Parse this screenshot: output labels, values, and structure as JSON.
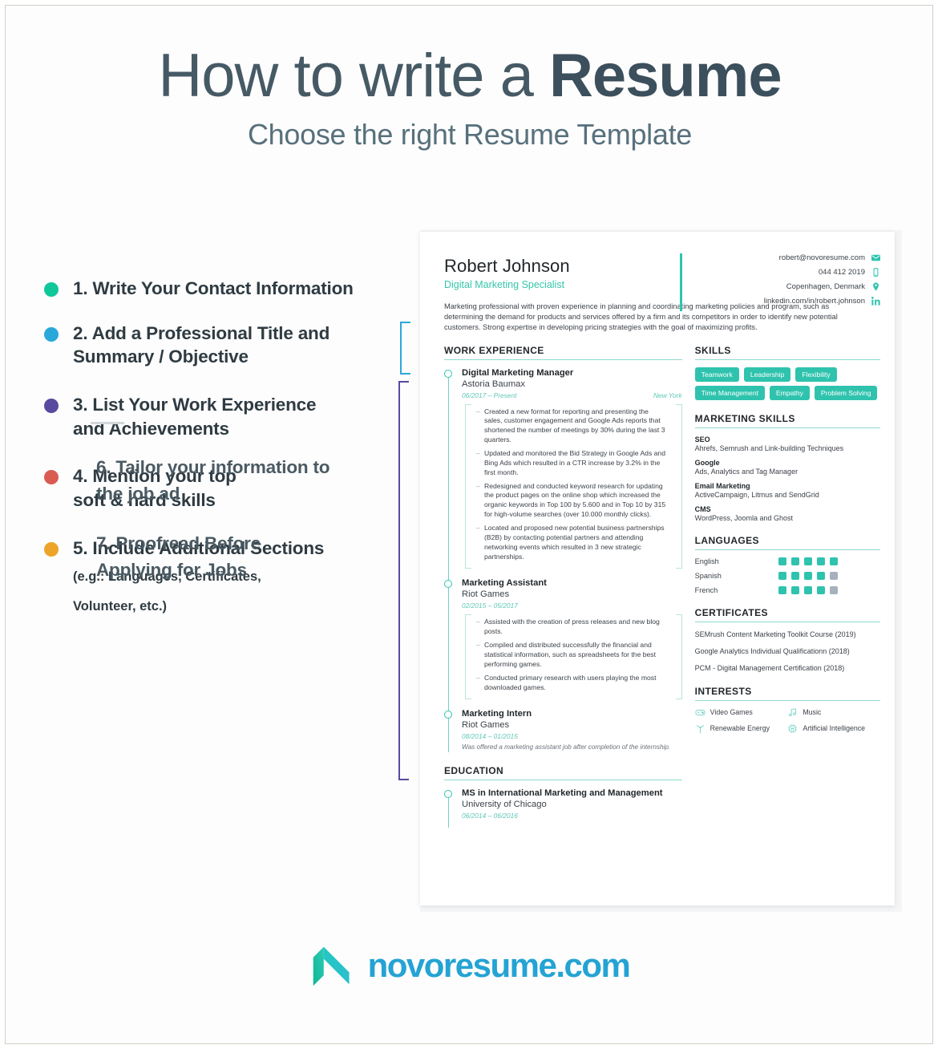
{
  "header": {
    "title_light": "How to write a ",
    "title_bold": "Resume",
    "subtitle": "Choose the right Resume Template"
  },
  "steps": [
    {
      "label": "1. Write Your Contact Information",
      "color": "#10c79a"
    },
    {
      "label": "2. Add a Professional Title and Summary / Objective",
      "color": "#2aa8da"
    },
    {
      "label": "3. List Your Work Experience and Achievements",
      "color": "#584a9e"
    },
    {
      "label": "4. Mention your top soft & hard skills",
      "color": "#d95b52"
    },
    {
      "label": "5. Include Additional Sections",
      "color": "#eda428",
      "note_line1": "(e.g.: Languages, Certificates,",
      "note_line2": "Volunteer, etc.)"
    }
  ],
  "steps_tail": [
    "6. Tailor your information to the job ad",
    "7. Proofread Before Applying for Jobs"
  ],
  "resume": {
    "name": "Robert Johnson",
    "role": "Digital Marketing Specialist",
    "contact": [
      {
        "text": "robert@novoresume.com",
        "icon": "email-icon"
      },
      {
        "text": "044 412 2019",
        "icon": "phone-icon"
      },
      {
        "text": "Copenhagen, Denmark",
        "icon": "location-pin-icon"
      },
      {
        "text": "linkedin.com/in/robert.johnson",
        "icon": "linkedin-icon"
      }
    ],
    "summary": "Marketing professional with proven experience in planning and coordinating marketing policies and program, such as determining the demand for products and services offered by a firm and its competitors in order to identify new potential customers. Strong expertise in developing pricing strategies with the goal of maximizing profits.",
    "work_heading": "WORK EXPERIENCE",
    "jobs": [
      {
        "title": "Digital Marketing Manager",
        "company": "Astoria Baumax",
        "date": "06/2017 – Present",
        "location": "New York",
        "bullets": [
          "Created a new format for reporting and presenting the sales, customer engagement and Google Ads reports that shortened the number of meetings by 30% during the last 3 quarters.",
          "Updated and monitored the Bid Strategy in Google Ads and Bing Ads which resulted in a CTR increase by 3.2% in the first month.",
          "Redesigned and conducted keyword research for updating the product pages on the online shop which increased the organic keywords in Top 100 by 5.600 and in Top 10 by 315 for high-volume searches (over 10.000 monthly clicks).",
          "Located and proposed new potential business partnerships (B2B) by contacting potential partners and attending networking events which resulted in 3 new strategic partnerships."
        ]
      },
      {
        "title": "Marketing Assistant",
        "company": "Riot Games",
        "date": "02/2015 – 05/2017",
        "location": "",
        "bullets": [
          "Assisted with the creation of press releases and new blog posts.",
          "Compiled and distributed successfully the financial and statistical information, such as spreadsheets for the best performing games.",
          "Conducted primary research with users playing the most downloaded games."
        ]
      },
      {
        "title": "Marketing Intern",
        "company": "Riot Games",
        "date": "08/2014 – 01/2015",
        "location": "",
        "note": "Was offered a marketing assistant job after completion of the internship.",
        "bullets": []
      }
    ],
    "education_heading": "EDUCATION",
    "education": [
      {
        "title": "MS in International Marketing and Management",
        "school": "University of Chicago",
        "date": "06/2014 – 06/2016"
      }
    ],
    "skills_heading": "SKILLS",
    "skills": [
      "Teamwork",
      "Leadership",
      "Flexibility",
      "Time Management",
      "Empathy",
      "Problem Solving"
    ],
    "marketing_heading": "MARKETING SKILLS",
    "marketing_skills": [
      {
        "name": "SEO",
        "desc": "Ahrefs, Semrush and Link-building Techniques"
      },
      {
        "name": "Google",
        "desc": "Ads, Analytics and Tag Manager"
      },
      {
        "name": "Email Marketing",
        "desc": "ActiveCampaign, Litmus and SendGrid"
      },
      {
        "name": "CMS",
        "desc": "WordPress, Joomla and Ghost"
      }
    ],
    "languages_heading": "LANGUAGES",
    "languages": [
      {
        "name": "English",
        "level": 5,
        "max": 5
      },
      {
        "name": "Spanish",
        "level": 4,
        "max": 5
      },
      {
        "name": "French",
        "level": 4,
        "max": 5
      }
    ],
    "certificates_heading": "CERTIFICATES",
    "certificates": [
      "SEMrush Content Marketing Toolkit Course (2019)",
      "Google Analytics Individual Qualificationn (2018)",
      "PCM - Digital Management Certification (2018)"
    ],
    "interests_heading": "INTERESTS",
    "interests": [
      {
        "label": "Video Games",
        "icon": "gamepad-icon"
      },
      {
        "label": "Music",
        "icon": "music-note-icon"
      },
      {
        "label": "Renewable Energy",
        "icon": "wind-turbine-icon"
      },
      {
        "label": "Artificial Intelligence",
        "icon": "ai-chip-icon"
      }
    ]
  },
  "annotations": {
    "summary_bracket_color": "#2aa8da",
    "experience_bracket_color": "#584a9e",
    "skills_bracket_color": "#d95b52",
    "extra_bracket_color": "#eda428"
  },
  "footer": {
    "logo_text": "novoresume.com",
    "logo_color": "#24a3d4",
    "mark_color_a": "#13c09b",
    "mark_color_b": "#2bbfd0"
  }
}
